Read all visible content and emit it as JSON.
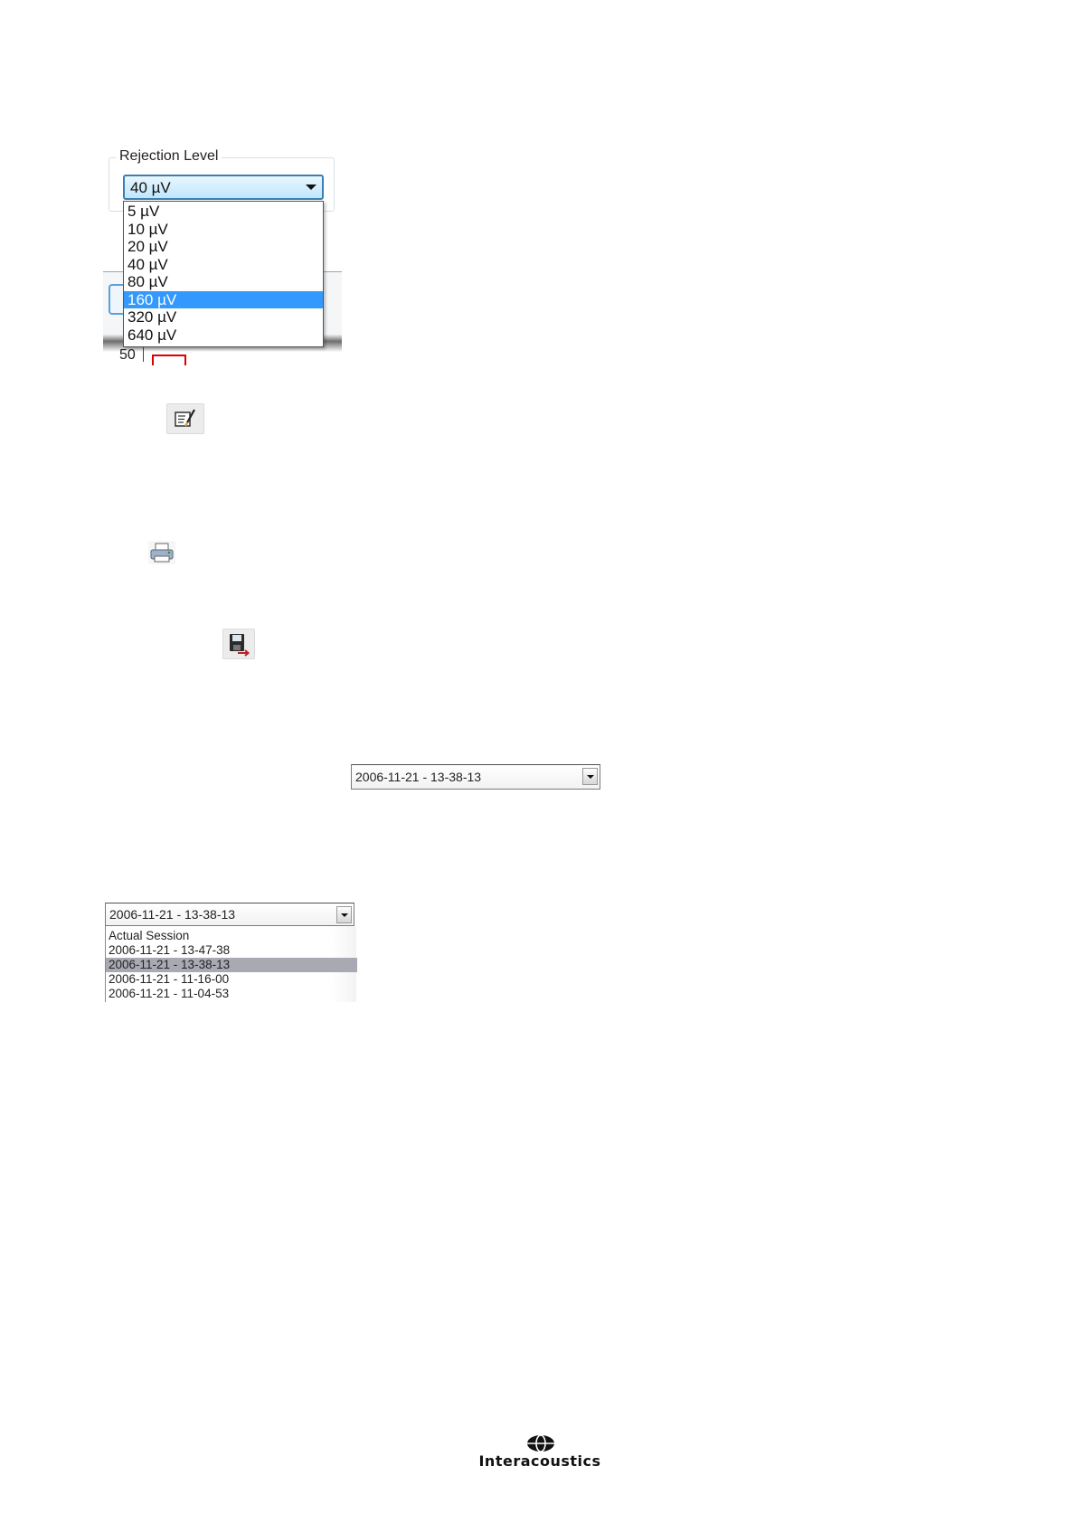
{
  "rejection_level": {
    "group_label": "Rejection Level",
    "selected_value": "40 µV",
    "options": [
      "5 µV",
      "10 µV",
      "20 µV",
      "40 µV",
      "80 µV",
      "160 µV",
      "320 µV",
      "640 µV"
    ],
    "highlighted_option": "160 µV",
    "background_axis_label": "50"
  },
  "icons": {
    "edit": "edit-report-icon",
    "print": "printer-icon",
    "save": "save-export-icon"
  },
  "session_combo_closed": {
    "selected_value": "2006-11-21 - 13-38-13"
  },
  "session_combo_open": {
    "selected_value": "2006-11-21 - 13-38-13",
    "options": [
      "Actual Session",
      "2006-11-21 - 13-47-38",
      "2006-11-21 - 13-38-13",
      "2006-11-21 - 11-16-00",
      "2006-11-21 - 11-04-53"
    ],
    "highlighted_option": "2006-11-21 - 13-38-13"
  },
  "logo": {
    "text": "Interacoustics"
  },
  "colors": {
    "highlight_blue": "#3399ff",
    "highlight_grey": "#a9a9b4"
  }
}
